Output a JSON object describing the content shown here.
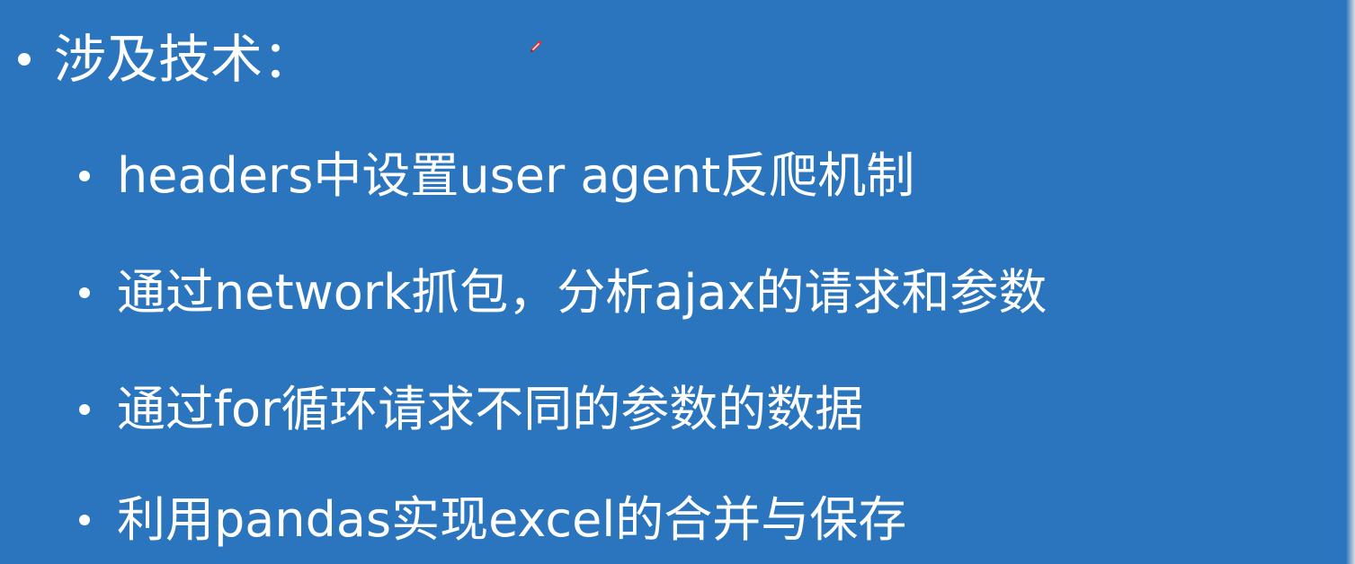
{
  "slide": {
    "heading": "涉及技术：",
    "items": [
      {
        "text": "headers中设置user agent反爬机制"
      },
      {
        "text": "通过network抓包，分析ajax的请求和参数"
      },
      {
        "text": "通过for循环请求不同的参数的数据"
      },
      {
        "text": "利用pandas实现excel的合并与保存"
      }
    ]
  },
  "colors": {
    "background": "#2a75bd",
    "text": "#ffffff",
    "pen_cursor": "#e03030"
  },
  "icons": {
    "cursor": "pen-cursor-icon"
  }
}
